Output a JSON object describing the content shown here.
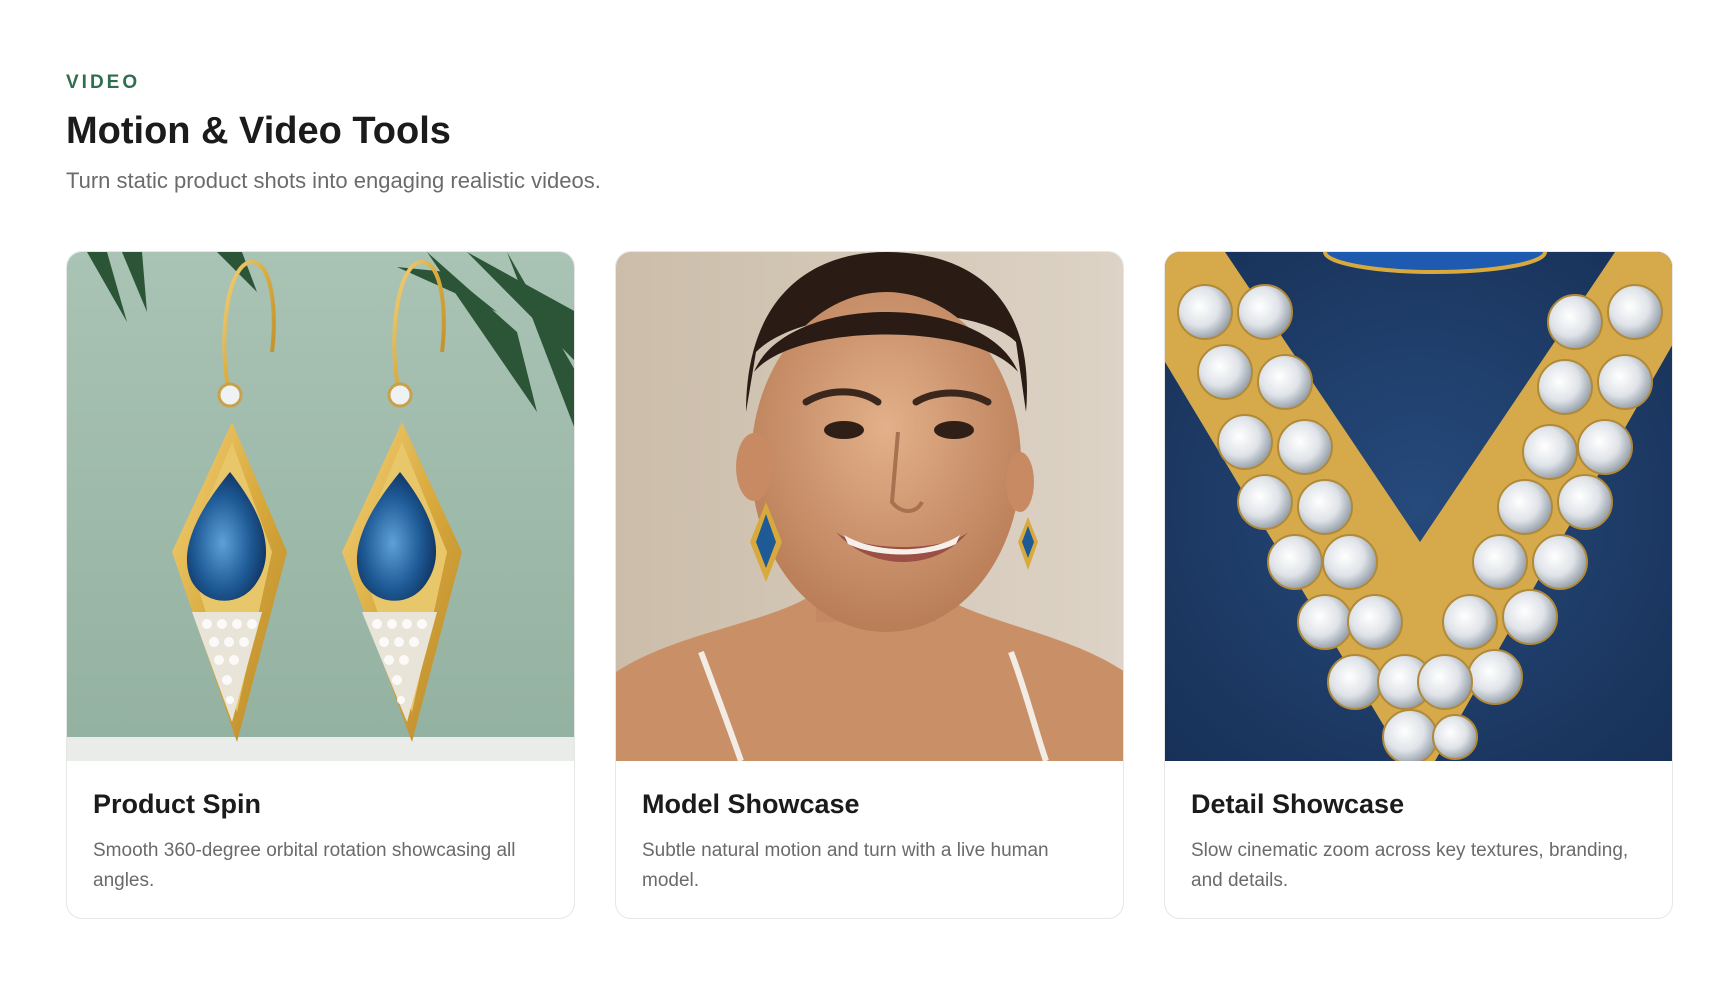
{
  "header": {
    "eyebrow": "VIDEO",
    "title": "Motion & Video Tools",
    "subtitle": "Turn static product shots into engaging realistic videos."
  },
  "cards": [
    {
      "title": "Product Spin",
      "description": "Smooth 360-degree orbital rotation showcasing all angles.",
      "image": "earrings-pair-image"
    },
    {
      "title": "Model Showcase",
      "description": "Subtle natural motion and turn with a live human model.",
      "image": "model-portrait-image"
    },
    {
      "title": "Detail Showcase",
      "description": "Slow cinematic zoom across key textures, branding, and details.",
      "image": "diamond-detail-image"
    }
  ],
  "colors": {
    "accent": "#2f6e4f",
    "title": "#1b1b1b",
    "muted": "#6b6b6b"
  }
}
